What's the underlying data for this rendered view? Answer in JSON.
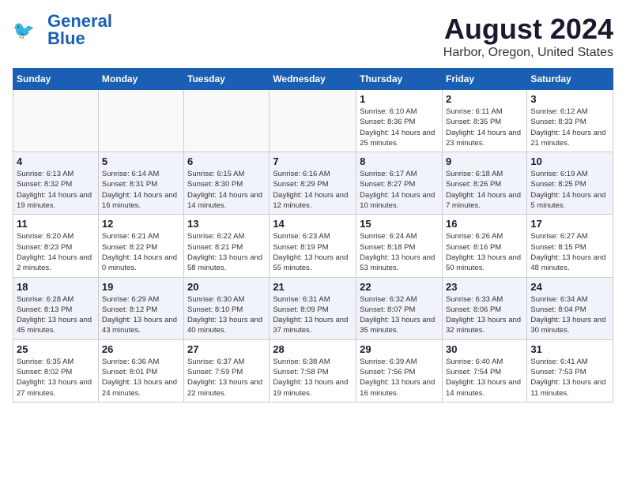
{
  "header": {
    "logo_line1": "General",
    "logo_line2": "Blue",
    "month": "August 2024",
    "location": "Harbor, Oregon, United States"
  },
  "days_of_week": [
    "Sunday",
    "Monday",
    "Tuesday",
    "Wednesday",
    "Thursday",
    "Friday",
    "Saturday"
  ],
  "weeks": [
    [
      {
        "date": "",
        "info": ""
      },
      {
        "date": "",
        "info": ""
      },
      {
        "date": "",
        "info": ""
      },
      {
        "date": "",
        "info": ""
      },
      {
        "date": "1",
        "sunrise": "6:10 AM",
        "sunset": "8:36 PM",
        "daylight": "14 hours and 25 minutes."
      },
      {
        "date": "2",
        "sunrise": "6:11 AM",
        "sunset": "8:35 PM",
        "daylight": "14 hours and 23 minutes."
      },
      {
        "date": "3",
        "sunrise": "6:12 AM",
        "sunset": "8:33 PM",
        "daylight": "14 hours and 21 minutes."
      }
    ],
    [
      {
        "date": "4",
        "sunrise": "6:13 AM",
        "sunset": "8:32 PM",
        "daylight": "14 hours and 19 minutes."
      },
      {
        "date": "5",
        "sunrise": "6:14 AM",
        "sunset": "8:31 PM",
        "daylight": "14 hours and 16 minutes."
      },
      {
        "date": "6",
        "sunrise": "6:15 AM",
        "sunset": "8:30 PM",
        "daylight": "14 hours and 14 minutes."
      },
      {
        "date": "7",
        "sunrise": "6:16 AM",
        "sunset": "8:29 PM",
        "daylight": "14 hours and 12 minutes."
      },
      {
        "date": "8",
        "sunrise": "6:17 AM",
        "sunset": "8:27 PM",
        "daylight": "14 hours and 10 minutes."
      },
      {
        "date": "9",
        "sunrise": "6:18 AM",
        "sunset": "8:26 PM",
        "daylight": "14 hours and 7 minutes."
      },
      {
        "date": "10",
        "sunrise": "6:19 AM",
        "sunset": "8:25 PM",
        "daylight": "14 hours and 5 minutes."
      }
    ],
    [
      {
        "date": "11",
        "sunrise": "6:20 AM",
        "sunset": "8:23 PM",
        "daylight": "14 hours and 2 minutes."
      },
      {
        "date": "12",
        "sunrise": "6:21 AM",
        "sunset": "8:22 PM",
        "daylight": "14 hours and 0 minutes."
      },
      {
        "date": "13",
        "sunrise": "6:22 AM",
        "sunset": "8:21 PM",
        "daylight": "13 hours and 58 minutes."
      },
      {
        "date": "14",
        "sunrise": "6:23 AM",
        "sunset": "8:19 PM",
        "daylight": "13 hours and 55 minutes."
      },
      {
        "date": "15",
        "sunrise": "6:24 AM",
        "sunset": "8:18 PM",
        "daylight": "13 hours and 53 minutes."
      },
      {
        "date": "16",
        "sunrise": "6:26 AM",
        "sunset": "8:16 PM",
        "daylight": "13 hours and 50 minutes."
      },
      {
        "date": "17",
        "sunrise": "6:27 AM",
        "sunset": "8:15 PM",
        "daylight": "13 hours and 48 minutes."
      }
    ],
    [
      {
        "date": "18",
        "sunrise": "6:28 AM",
        "sunset": "8:13 PM",
        "daylight": "13 hours and 45 minutes."
      },
      {
        "date": "19",
        "sunrise": "6:29 AM",
        "sunset": "8:12 PM",
        "daylight": "13 hours and 43 minutes."
      },
      {
        "date": "20",
        "sunrise": "6:30 AM",
        "sunset": "8:10 PM",
        "daylight": "13 hours and 40 minutes."
      },
      {
        "date": "21",
        "sunrise": "6:31 AM",
        "sunset": "8:09 PM",
        "daylight": "13 hours and 37 minutes."
      },
      {
        "date": "22",
        "sunrise": "6:32 AM",
        "sunset": "8:07 PM",
        "daylight": "13 hours and 35 minutes."
      },
      {
        "date": "23",
        "sunrise": "6:33 AM",
        "sunset": "8:06 PM",
        "daylight": "13 hours and 32 minutes."
      },
      {
        "date": "24",
        "sunrise": "6:34 AM",
        "sunset": "8:04 PM",
        "daylight": "13 hours and 30 minutes."
      }
    ],
    [
      {
        "date": "25",
        "sunrise": "6:35 AM",
        "sunset": "8:02 PM",
        "daylight": "13 hours and 27 minutes."
      },
      {
        "date": "26",
        "sunrise": "6:36 AM",
        "sunset": "8:01 PM",
        "daylight": "13 hours and 24 minutes."
      },
      {
        "date": "27",
        "sunrise": "6:37 AM",
        "sunset": "7:59 PM",
        "daylight": "13 hours and 22 minutes."
      },
      {
        "date": "28",
        "sunrise": "6:38 AM",
        "sunset": "7:58 PM",
        "daylight": "13 hours and 19 minutes."
      },
      {
        "date": "29",
        "sunrise": "6:39 AM",
        "sunset": "7:56 PM",
        "daylight": "13 hours and 16 minutes."
      },
      {
        "date": "30",
        "sunrise": "6:40 AM",
        "sunset": "7:54 PM",
        "daylight": "13 hours and 14 minutes."
      },
      {
        "date": "31",
        "sunrise": "6:41 AM",
        "sunset": "7:53 PM",
        "daylight": "13 hours and 11 minutes."
      }
    ]
  ]
}
